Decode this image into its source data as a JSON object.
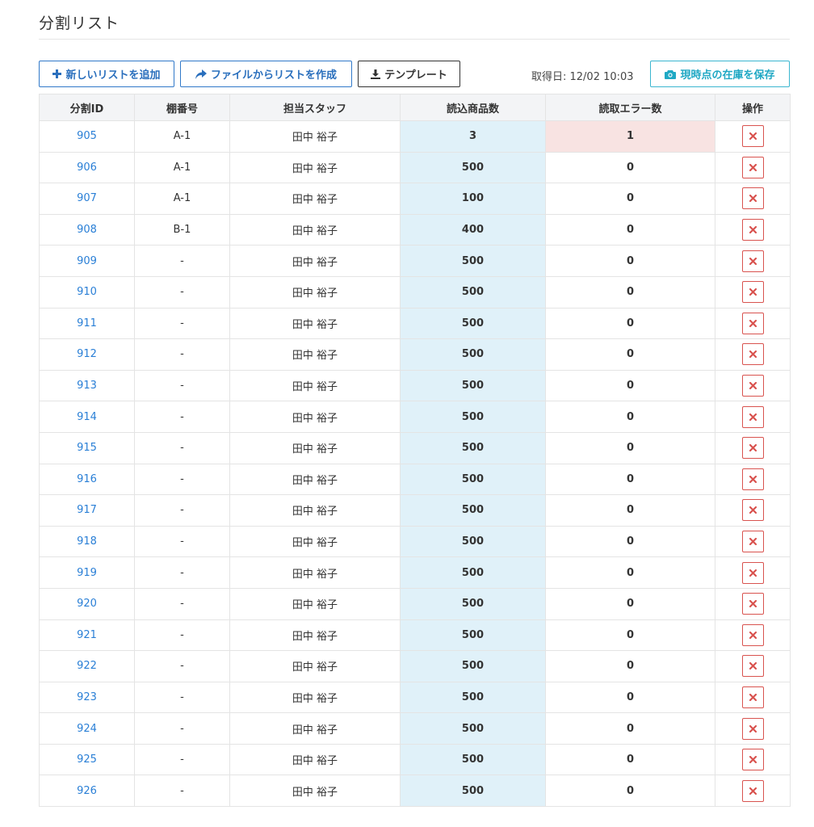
{
  "page": {
    "title": "分割リスト"
  },
  "toolbar": {
    "add_label": "新しいリストを追加",
    "file_label": "ファイルからリストを作成",
    "template_label": "テンプレート",
    "fetch_date": "取得日: 12/02 10:03",
    "save_label": "現時点の在庫を保存"
  },
  "colors": {
    "link": "#2a7fd6",
    "accent": "#3179c9",
    "save_accent": "#1fa8c4",
    "danger": "#d9534f",
    "read_bg": "#e0f1f9",
    "error_bg": "#f8e3e2"
  },
  "table": {
    "headers": [
      "分割ID",
      "棚番号",
      "担当スタッフ",
      "読込商品数",
      "読取エラー数",
      "操作"
    ],
    "rows": [
      {
        "id": "905",
        "shelf": "A-1",
        "staff": "田中 裕子",
        "read": "3",
        "errors": "1"
      },
      {
        "id": "906",
        "shelf": "A-1",
        "staff": "田中 裕子",
        "read": "500",
        "errors": "0"
      },
      {
        "id": "907",
        "shelf": "A-1",
        "staff": "田中 裕子",
        "read": "100",
        "errors": "0"
      },
      {
        "id": "908",
        "shelf": "B-1",
        "staff": "田中 裕子",
        "read": "400",
        "errors": "0"
      },
      {
        "id": "909",
        "shelf": "-",
        "staff": "田中 裕子",
        "read": "500",
        "errors": "0"
      },
      {
        "id": "910",
        "shelf": "-",
        "staff": "田中 裕子",
        "read": "500",
        "errors": "0"
      },
      {
        "id": "911",
        "shelf": "-",
        "staff": "田中 裕子",
        "read": "500",
        "errors": "0"
      },
      {
        "id": "912",
        "shelf": "-",
        "staff": "田中 裕子",
        "read": "500",
        "errors": "0"
      },
      {
        "id": "913",
        "shelf": "-",
        "staff": "田中 裕子",
        "read": "500",
        "errors": "0"
      },
      {
        "id": "914",
        "shelf": "-",
        "staff": "田中 裕子",
        "read": "500",
        "errors": "0"
      },
      {
        "id": "915",
        "shelf": "-",
        "staff": "田中 裕子",
        "read": "500",
        "errors": "0"
      },
      {
        "id": "916",
        "shelf": "-",
        "staff": "田中 裕子",
        "read": "500",
        "errors": "0"
      },
      {
        "id": "917",
        "shelf": "-",
        "staff": "田中 裕子",
        "read": "500",
        "errors": "0"
      },
      {
        "id": "918",
        "shelf": "-",
        "staff": "田中 裕子",
        "read": "500",
        "errors": "0"
      },
      {
        "id": "919",
        "shelf": "-",
        "staff": "田中 裕子",
        "read": "500",
        "errors": "0"
      },
      {
        "id": "920",
        "shelf": "-",
        "staff": "田中 裕子",
        "read": "500",
        "errors": "0"
      },
      {
        "id": "921",
        "shelf": "-",
        "staff": "田中 裕子",
        "read": "500",
        "errors": "0"
      },
      {
        "id": "922",
        "shelf": "-",
        "staff": "田中 裕子",
        "read": "500",
        "errors": "0"
      },
      {
        "id": "923",
        "shelf": "-",
        "staff": "田中 裕子",
        "read": "500",
        "errors": "0"
      },
      {
        "id": "924",
        "shelf": "-",
        "staff": "田中 裕子",
        "read": "500",
        "errors": "0"
      },
      {
        "id": "925",
        "shelf": "-",
        "staff": "田中 裕子",
        "read": "500",
        "errors": "0"
      },
      {
        "id": "926",
        "shelf": "-",
        "staff": "田中 裕子",
        "read": "500",
        "errors": "0"
      }
    ]
  }
}
